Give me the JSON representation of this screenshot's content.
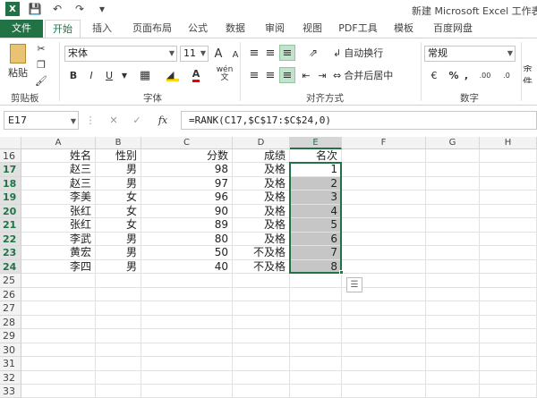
{
  "app": {
    "title": "新建 Microsoft Excel 工作表.xl"
  },
  "tabs": [
    "文件",
    "开始",
    "插入",
    "页面布局",
    "公式",
    "数据",
    "审阅",
    "视图",
    "PDF工具",
    "模板",
    "百度网盘"
  ],
  "ribbon": {
    "clipboard": {
      "paste": "粘贴",
      "group": "剪贴板"
    },
    "font": {
      "name": "宋体",
      "size": "11",
      "group": "字体",
      "bold": "B",
      "italic": "I",
      "underline": "U",
      "grow": "A",
      "shrink": "A",
      "wen": "wén"
    },
    "alignment": {
      "wrap": "自动换行",
      "merge": "合并后居中",
      "group": "对齐方式"
    },
    "number": {
      "format": "常规",
      "percent": "%",
      "comma": ",",
      "dec_inc": ".00",
      "dec_dec": ".0",
      "group": "数字"
    },
    "cond": {
      "label": "条件"
    }
  },
  "formula_bar": {
    "name_box": "E17",
    "fx": "fx",
    "formula": "=RANK(C17,$C$17:$C$24,0)"
  },
  "columns": [
    "A",
    "B",
    "C",
    "D",
    "E",
    "F",
    "G",
    "H"
  ],
  "rows": [
    "16",
    "17",
    "18",
    "19",
    "20",
    "21",
    "22",
    "23",
    "24",
    "25",
    "26",
    "27",
    "28",
    "29",
    "30",
    "31",
    "32",
    "33"
  ],
  "table": {
    "header": [
      "姓名",
      "性别",
      "分数",
      "成绩",
      "名次"
    ],
    "data": [
      [
        "赵三",
        "男",
        "98",
        "及格",
        "1"
      ],
      [
        "赵三",
        "男",
        "97",
        "及格",
        "2"
      ],
      [
        "李美",
        "女",
        "96",
        "及格",
        "3"
      ],
      [
        "张红",
        "女",
        "90",
        "及格",
        "4"
      ],
      [
        "张红",
        "女",
        "89",
        "及格",
        "5"
      ],
      [
        "李武",
        "男",
        "80",
        "及格",
        "6"
      ],
      [
        "黄宏",
        "男",
        "50",
        "不及格",
        "7"
      ],
      [
        "李四",
        "男",
        "40",
        "不及格",
        "8"
      ]
    ]
  },
  "colors": {
    "accent": "#217346",
    "selection_fill": "#c6c6c6"
  }
}
